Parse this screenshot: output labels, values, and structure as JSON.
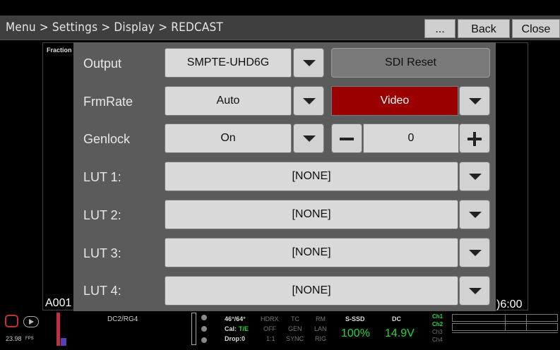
{
  "header": {
    "breadcrumb": "Menu > Settings > Display > REDCAST",
    "more_label": "...",
    "back_label": "Back",
    "close_label": "Close"
  },
  "overlay": {
    "fraction_label": "Fraction",
    "clip_name": "A001",
    "timecode_tail": ")6:00"
  },
  "panel": {
    "rows": [
      {
        "label": "Output",
        "value": "SMPTE-UHD6G",
        "button": "SDI Reset"
      },
      {
        "label": "FrmRate",
        "value": "Auto",
        "mode": "Video"
      },
      {
        "label": "Genlock",
        "value": "On",
        "stepper_value": "0"
      },
      {
        "label": "LUT 1:",
        "value": "[NONE]"
      },
      {
        "label": "LUT 2:",
        "value": "[NONE]"
      },
      {
        "label": "LUT 3:",
        "value": "[NONE]"
      },
      {
        "label": "LUT 4:",
        "value": "[NONE]"
      }
    ]
  },
  "footer": {
    "fps": "23.98",
    "fps_unit": "FPS",
    "color_space": "DC2/RG4",
    "temp": "46°/64°",
    "cal_prefix": "Cal:",
    "cal_value": "T/E",
    "drop": "Drop:0",
    "hdrx": "HDRX",
    "hdrx_val": "OFF",
    "ratio": "1:1",
    "tc": "TC",
    "tc_val": "GEN",
    "tc_sync": "SYNC",
    "rm": "RM",
    "rm_val": "LAN",
    "rm_rig": "RIG",
    "media_label": "S-SSD",
    "media_value": "100%",
    "dc_label": "DC",
    "dc_value": "14.9V",
    "channels": [
      "Ch1",
      "Ch2",
      "Ch3",
      "Ch4"
    ],
    "colors": {
      "green": "#27d63c",
      "red": "#c0303e",
      "dim": "#777777"
    }
  }
}
